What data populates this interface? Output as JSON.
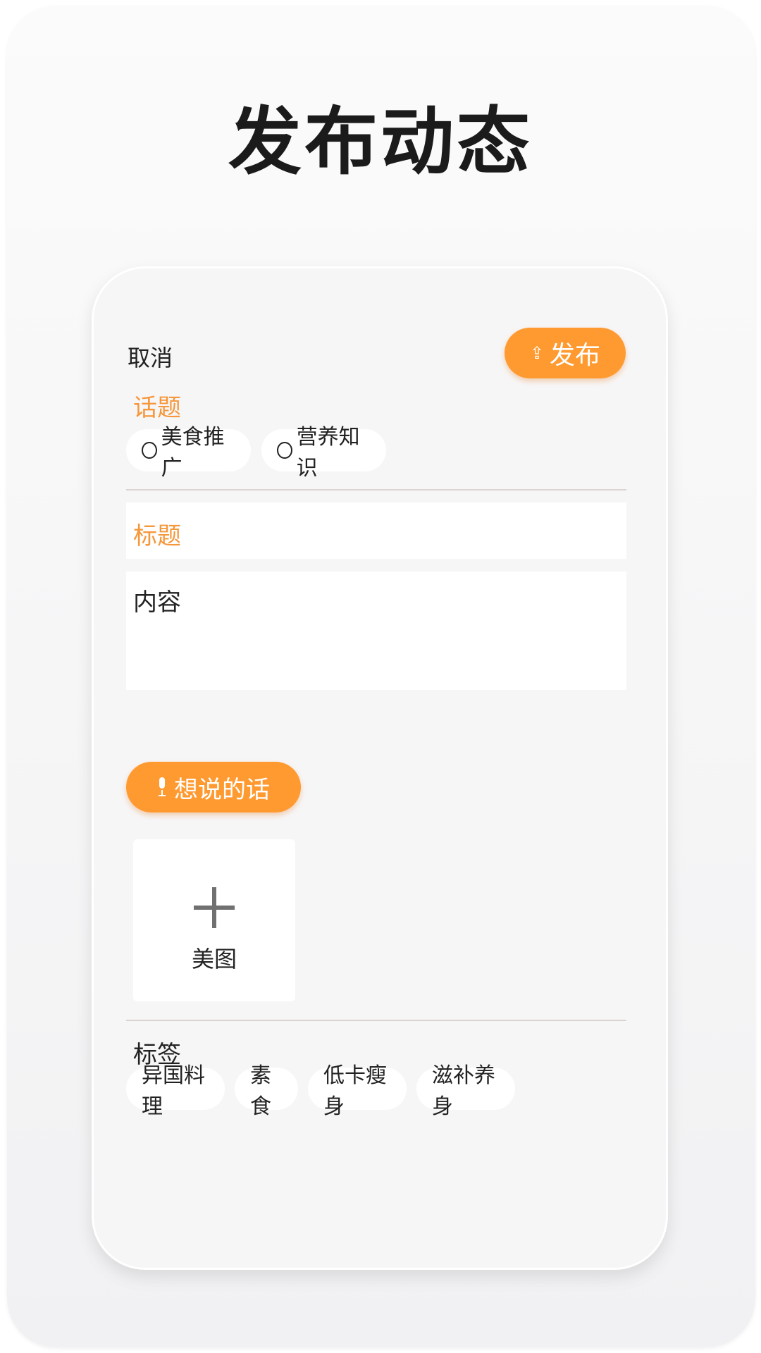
{
  "page": {
    "title": "发布动态"
  },
  "toolbar": {
    "cancel_label": "取消",
    "publish_label": "发布",
    "publish_icon": "upload-icon"
  },
  "topics": {
    "title": "话题",
    "items": [
      {
        "label": "美食推广"
      },
      {
        "label": "营养知识"
      }
    ]
  },
  "form": {
    "title_placeholder": "标题",
    "content_placeholder": "内容"
  },
  "voice": {
    "label": "想说的话",
    "icon": "mic-icon"
  },
  "image_upload": {
    "label": "美图",
    "icon": "plus-icon"
  },
  "tags": {
    "title": "标签",
    "items": [
      {
        "label": "异国料理"
      },
      {
        "label": "素食"
      },
      {
        "label": "低卡瘦身"
      },
      {
        "label": "滋补养身"
      }
    ]
  },
  "colors": {
    "accent": "#ff9a30",
    "accent_text": "#f5973a",
    "card_bg": "#f7f6f7"
  }
}
